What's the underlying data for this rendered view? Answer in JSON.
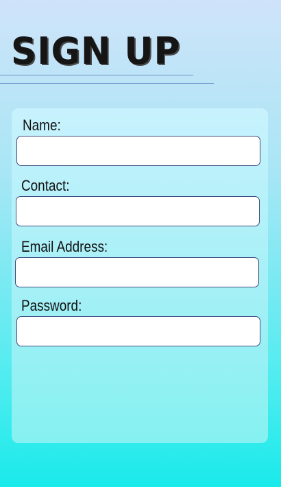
{
  "header": {
    "title": "SIGN UP"
  },
  "form": {
    "fields": [
      {
        "label": "Name:",
        "value": "",
        "placeholder": ""
      },
      {
        "label": "Contact:",
        "value": "",
        "placeholder": ""
      },
      {
        "label": "Email Address:",
        "value": "",
        "placeholder": ""
      },
      {
        "label": "Password:",
        "value": "",
        "placeholder": ""
      }
    ]
  },
  "colors": {
    "background_top": "#cfe3f9",
    "background_bottom": "#1aeaea",
    "card": "#b6f1f9",
    "input_border": "#3c4a7c",
    "title": "#151515"
  }
}
